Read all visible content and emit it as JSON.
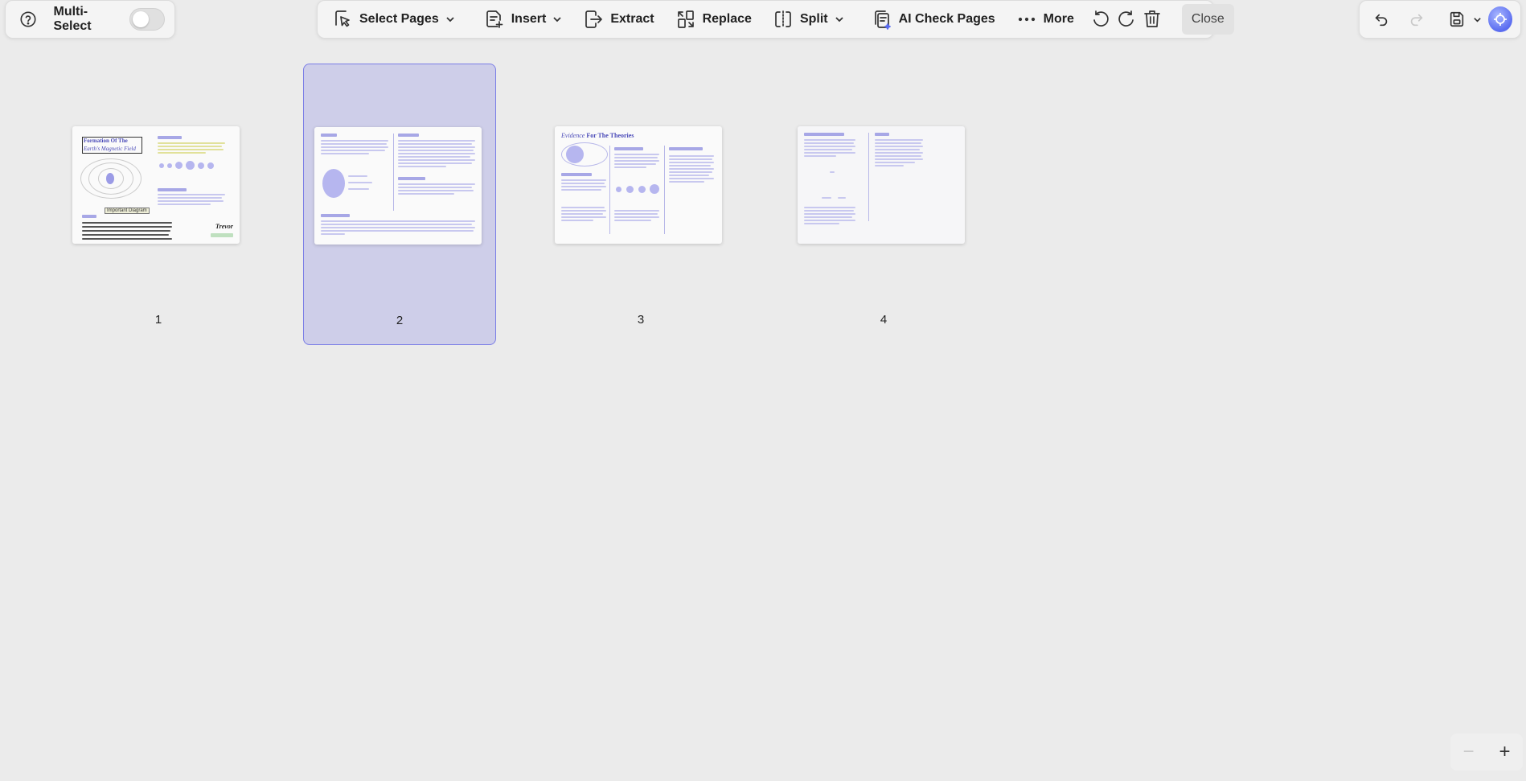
{
  "left_panel": {
    "help_icon": "question-circle-icon",
    "multiselect_label": "Multi-Select",
    "multiselect_on": false
  },
  "toolbar": {
    "select_pages": "Select Pages",
    "insert": "Insert",
    "extract": "Extract",
    "replace": "Replace",
    "split": "Split",
    "ai_check": "AI Check Pages",
    "more": "More",
    "close": "Close"
  },
  "right_panel": {
    "undo_icon": "undo-icon",
    "redo_icon": "redo-icon",
    "save_icon": "save-icon",
    "avatar_icon": "ai-assistant-icon"
  },
  "pages": [
    {
      "number": "1",
      "selected": false,
      "title_line1": "Formation Of The",
      "title_line2": "Earth's Magnetic Field",
      "label": "Important Diagram",
      "signature": "Trevor"
    },
    {
      "number": "2",
      "selected": true
    },
    {
      "number": "3",
      "selected": false,
      "title_word1": "Evidence",
      "title_rest": "For The Theories"
    },
    {
      "number": "4",
      "selected": false
    }
  ],
  "zoom": {
    "minus": "−",
    "plus": "+"
  },
  "colors": {
    "accent": "#6a6fe0",
    "selection": "#c9c9ee",
    "background": "#ebebeb"
  }
}
